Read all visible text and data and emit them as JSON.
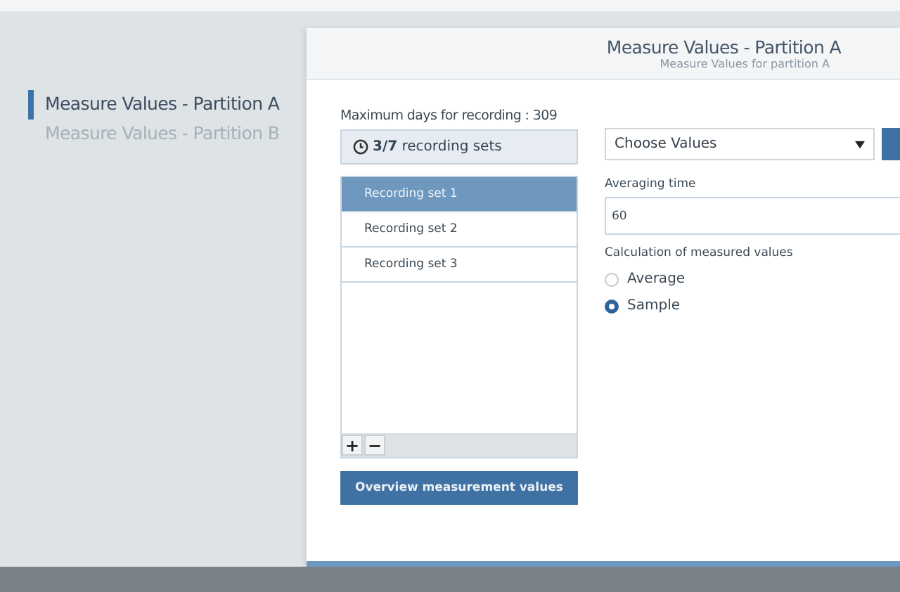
{
  "sidebar": {
    "items": [
      {
        "label": "Measure Values - Partition A",
        "selected": true
      },
      {
        "label": "Measure Values - Partition B",
        "selected": false
      }
    ]
  },
  "panel": {
    "title": "Measure Values - Partition A",
    "subtitle": "Measure Values for partition A"
  },
  "max_days_label": "Maximum days for recording : 309",
  "sets_summary": "**3/7** recording sets",
  "recording_sets": [
    {
      "label": "Recording set 1",
      "selected": true
    },
    {
      "label": "Recording set 2",
      "selected": false
    },
    {
      "label": "Recording set 3",
      "selected": false
    }
  ],
  "list_buttons": [
    "+",
    "−"
  ],
  "overview_button": "Overview measurement values",
  "values_select": {
    "value": "Choose Values"
  },
  "averaging_time": {
    "label": "Averaging time",
    "value": "60"
  },
  "calculation": {
    "label": "Calculation of measured values",
    "options": [
      {
        "label": "Average",
        "selected": false
      },
      {
        "label": "Sample",
        "selected": true
      }
    ]
  }
}
